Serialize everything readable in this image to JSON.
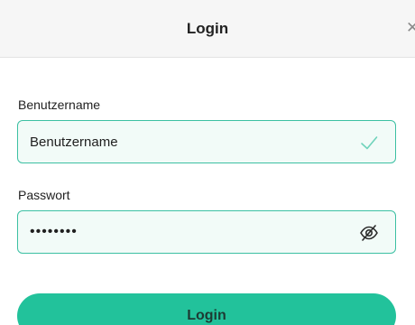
{
  "header": {
    "title": "Login"
  },
  "form": {
    "username": {
      "label": "Benutzername",
      "value": "Benutzername",
      "status_icon": "check-icon"
    },
    "password": {
      "label": "Passwort",
      "value": "••••••••",
      "toggle_icon": "eye-off-icon"
    },
    "submit_label": "Login"
  },
  "colors": {
    "accent": "#22c29b",
    "field_border": "#3cc0a3",
    "field_bg": "#f2fbf8",
    "header_bg": "#f6f6f6"
  }
}
